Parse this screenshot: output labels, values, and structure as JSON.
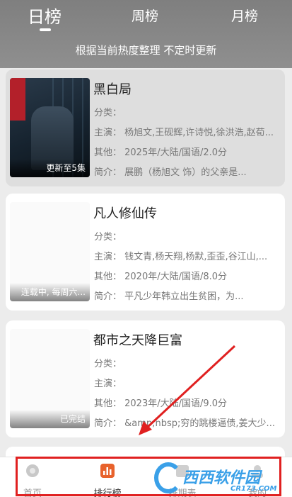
{
  "tabs": [
    {
      "label": "日榜"
    },
    {
      "label": "周榜"
    },
    {
      "label": "月榜"
    }
  ],
  "subtitle": "根据当前热度整理 不定时更新",
  "items": [
    {
      "title": "黑白局",
      "category": "分类：",
      "cast": "主演：  杨旭文,王砚辉,许诗悦,徐洪浩,赵荀...",
      "other": "其他：  2025年/大陆/国语/2.0分",
      "intro": "简介：      展鹏（杨旭文 饰）的父亲是...",
      "badge": "更新至5集",
      "poster_icon": "drama-poster-image"
    },
    {
      "title": "凡人修仙传",
      "category": "分类：",
      "cast": "主演：  钱文青,杨天翔,杨默,歪歪,谷江山,...",
      "other": "其他：  2020年/大陆/国语/8.0分",
      "intro": "简介：      平凡少年韩立出生贫困，为...",
      "badge": "连载中, 每周六...",
      "poster_icon": "blank-poster"
    },
    {
      "title": "都市之天降巨富",
      "category": "分类：",
      "cast": "主演：",
      "other": "其他：  2023年/大陆/国语/9.0分",
      "intro": "简介：  &amp;nbsp;穷的跳楼逼债,姜大少...",
      "badge": "已完结",
      "poster_icon": "blank-poster"
    }
  ],
  "bottom_nav": [
    {
      "label": "首页",
      "icon": "home-icon"
    },
    {
      "label": "排行榜",
      "icon": "ranking-icon"
    },
    {
      "label": "排期表",
      "icon": "schedule-icon"
    },
    {
      "label": "我的",
      "icon": "profile-icon"
    }
  ],
  "watermark": {
    "main": "西西软件园",
    "sub": "CR173.COM"
  },
  "colors": {
    "header": "#8a8a8a",
    "annotation": "#e02020",
    "ranking_icon": "#e8622c",
    "watermark": "#3aa0e8"
  }
}
